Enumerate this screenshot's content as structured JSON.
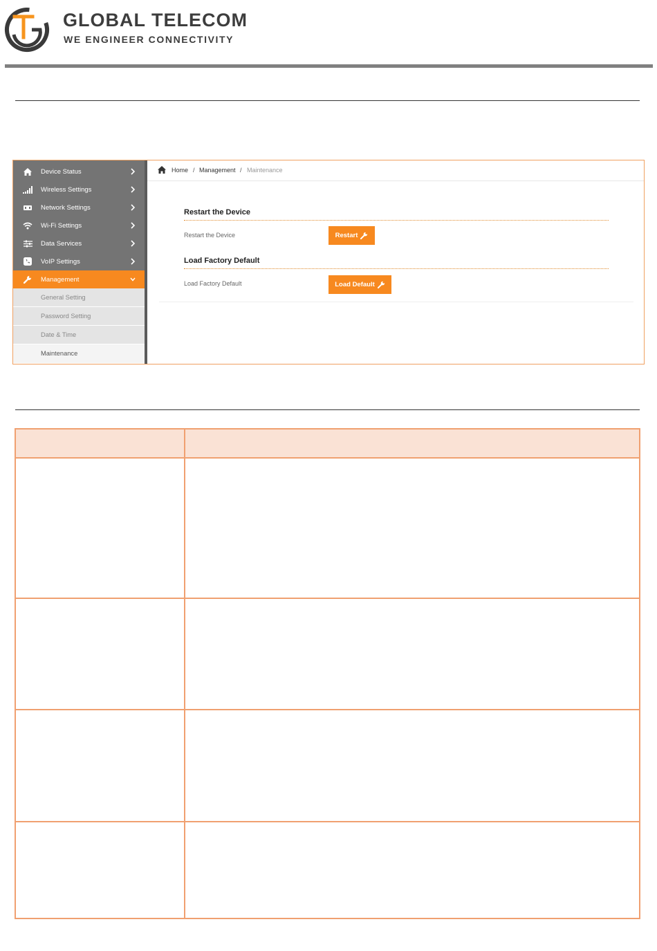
{
  "header": {
    "brand_title": "GLOBAL TELECOM",
    "brand_tagline": "WE ENGINEER CONNECTIVITY",
    "logo_letter": "T",
    "accent_color": "#f7941d",
    "bar_color": "#808080"
  },
  "ui": {
    "sidebar": {
      "items": [
        {
          "label": "Device Status",
          "icon": "home-icon"
        },
        {
          "label": "Wireless Settings",
          "icon": "signal-icon"
        },
        {
          "label": "Network Settings",
          "icon": "network-icon"
        },
        {
          "label": "Wi-Fi Settings",
          "icon": "wifi-icon"
        },
        {
          "label": "Data Services",
          "icon": "sliders-icon"
        },
        {
          "label": "VoIP Settings",
          "icon": "phone-icon"
        },
        {
          "label": "Management",
          "icon": "wrench-icon",
          "expanded": true
        }
      ],
      "subitems": [
        {
          "label": "General Setting"
        },
        {
          "label": "Password Setting"
        },
        {
          "label": "Date & Time"
        },
        {
          "label": "Maintenance",
          "current": true
        }
      ]
    },
    "breadcrumb": {
      "home": "Home",
      "sep": "/",
      "section": "Management",
      "current": "Maintenance"
    },
    "restart": {
      "title": "Restart the Device",
      "label": "Restart the Device",
      "button": "Restart"
    },
    "factory": {
      "title": "Load Factory Default",
      "label": "Load Factory Default",
      "button": "Load Default"
    },
    "accent_color": "#f7891f"
  },
  "table": {
    "header": [
      "",
      ""
    ],
    "rows": [
      [
        "",
        ""
      ],
      [
        "",
        ""
      ],
      [
        "",
        ""
      ],
      [
        "",
        ""
      ]
    ],
    "border_color": "#f0a070",
    "header_bg": "#fae2d5"
  }
}
